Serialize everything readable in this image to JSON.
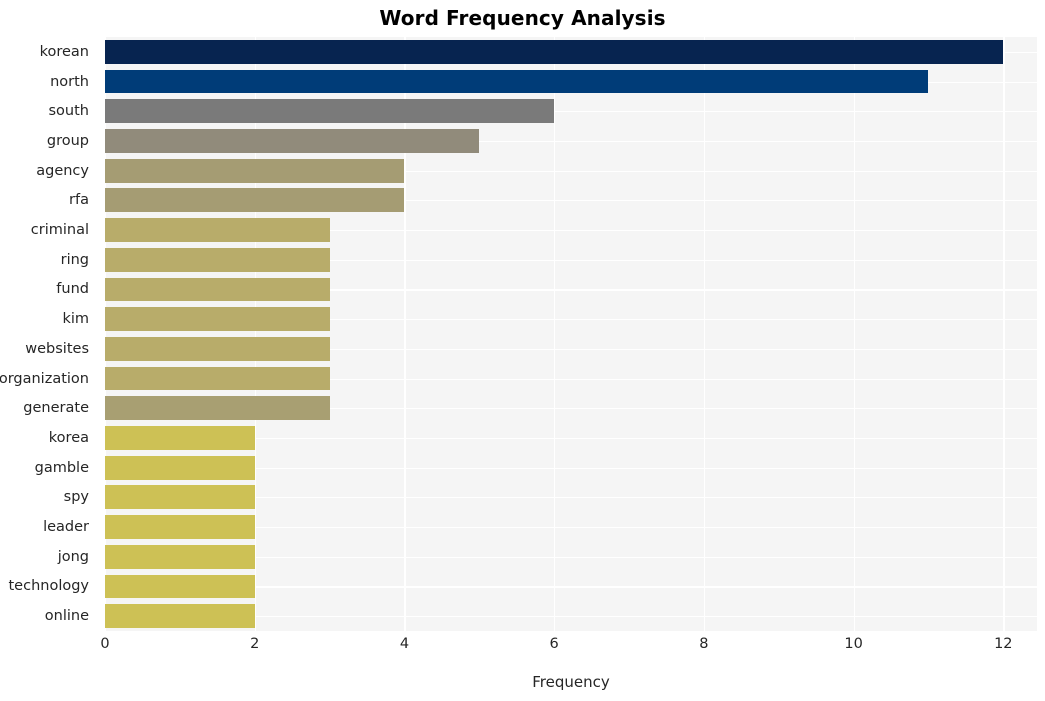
{
  "chart_data": {
    "type": "bar",
    "orientation": "horizontal",
    "title": "Word Frequency Analysis",
    "xlabel": "Frequency",
    "ylabel": "",
    "categories": [
      "korean",
      "north",
      "south",
      "group",
      "agency",
      "rfa",
      "criminal",
      "ring",
      "fund",
      "kim",
      "websites",
      "organization",
      "generate",
      "korea",
      "gamble",
      "spy",
      "leader",
      "jong",
      "technology",
      "online"
    ],
    "values": [
      12,
      11,
      6,
      5,
      4,
      4,
      3,
      3,
      3,
      3,
      3,
      3,
      3,
      2,
      2,
      2,
      2,
      2,
      2,
      2
    ],
    "bar_colors": [
      "#072450",
      "#003c78",
      "#7a7a7a",
      "#918b7b",
      "#a59c73",
      "#a59c73",
      "#b8ac6a",
      "#b8ac6a",
      "#b8ac6a",
      "#b8ac6a",
      "#b8ac6a",
      "#b8ac6a",
      "#a89f72",
      "#cdc155",
      "#cdc155",
      "#cdc155",
      "#cdc155",
      "#cdc155",
      "#cdc155",
      "#cdc155"
    ],
    "xticks": [
      0,
      2,
      4,
      6,
      8,
      10,
      12
    ],
    "xtick_labels": [
      "0",
      "2",
      "4",
      "6",
      "8",
      "10",
      "12"
    ],
    "xlim": [
      0,
      12.45
    ],
    "grid": true,
    "grid_color": "#ffffff",
    "plot_background": "#f5f5f5",
    "figure_background": "#ffffff",
    "legend": null
  }
}
